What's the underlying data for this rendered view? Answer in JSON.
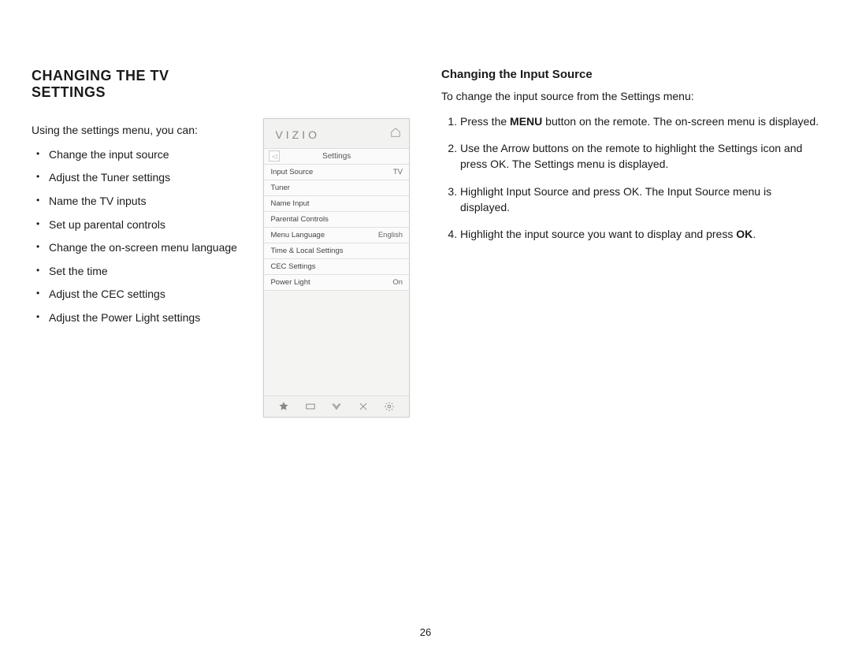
{
  "page_number": "26",
  "section_title": "CHANGING THE TV SETTINGS",
  "intro": "Using the settings menu, you can:",
  "capabilities": [
    "Change the input source",
    "Adjust the Tuner settings",
    "Name the TV inputs",
    "Set up parental controls",
    "Change the on-screen menu language",
    "Set the time",
    "Adjust the CEC settings",
    "Adjust the Power Light settings"
  ],
  "tv_menu": {
    "brand": "VIZIO",
    "crumb": "Settings",
    "rows": [
      {
        "label": "Input Source",
        "value": "TV"
      },
      {
        "label": "Tuner",
        "value": ""
      },
      {
        "label": "Name Input",
        "value": ""
      },
      {
        "label": "Parental Controls",
        "value": ""
      },
      {
        "label": "Menu Language",
        "value": "English"
      },
      {
        "label": "Time & Local Settings",
        "value": ""
      },
      {
        "label": "CEC Settings",
        "value": ""
      },
      {
        "label": "Power Light",
        "value": "On"
      }
    ],
    "footer_icons": [
      "star-icon",
      "wide-icon",
      "v-icon",
      "close-icon",
      "gear-icon"
    ]
  },
  "subsection": {
    "title": "Changing the Input Source",
    "lead": "To change the input source from the Settings menu:",
    "steps": [
      {
        "pre": "Press the ",
        "bold": "MENU",
        "post": " button on the remote. The on-screen menu is displayed."
      },
      {
        "pre": "Use the Arrow buttons on the remote to highlight the Settings icon and press OK. The Settings menu is displayed.",
        "bold": "",
        "post": ""
      },
      {
        "pre": "Highlight Input Source and press OK. The Input Source menu is displayed.",
        "bold": "",
        "post": ""
      },
      {
        "pre": "Highlight the input source you want to display and press ",
        "bold": "OK",
        "post": "."
      }
    ]
  }
}
